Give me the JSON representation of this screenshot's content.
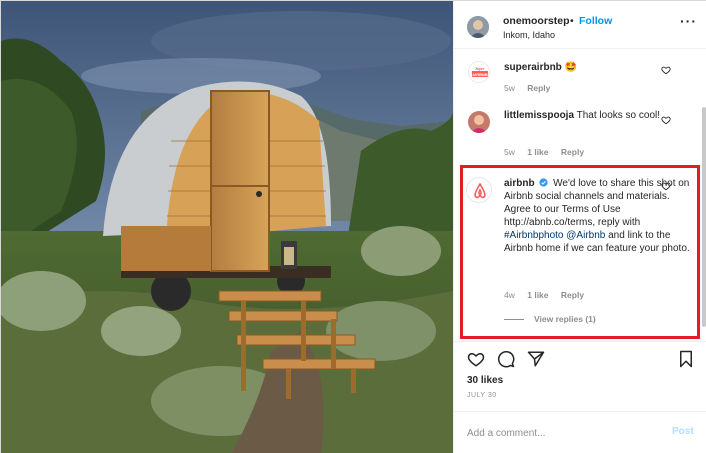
{
  "header": {
    "username": "onemoorstep",
    "separator": "•",
    "follow_label": "Follow",
    "location": "Inkom, Idaho",
    "more_label": "···"
  },
  "comments": [
    {
      "username": "superairbnb",
      "text": "🤩",
      "time": "5w",
      "likes": "",
      "reply_label": "Reply",
      "avatar_text": "AIRBNB"
    },
    {
      "username": "littlemisspooja",
      "text": "That looks so cool!",
      "time": "5w",
      "likes": "1 like",
      "reply_label": "Reply"
    },
    {
      "username": "airbnb",
      "verified": true,
      "text_before": "We'd love to share this shot on Airbnb social channels and materials. Agree to our Terms of Use http://abnb.co/terms, reply with ",
      "link1": "#Airbnbphoto",
      "link2": "@Airbnb",
      "text_after": " and link to the Airbnb home if we can feature your photo.",
      "time": "4w",
      "likes": "1 like",
      "reply_label": "Reply",
      "view_replies": "View replies (1)"
    }
  ],
  "post": {
    "likes": "30 likes",
    "date": "JULY 30"
  },
  "add_comment": {
    "placeholder": "Add a comment...",
    "post_label": "Post"
  },
  "colors": {
    "accent": "#0095f6",
    "highlight": "#e41c25",
    "airbnb": "#ff5a5f",
    "muted": "#8e8e8e"
  },
  "icons": [
    "heart-icon",
    "comment-icon",
    "share-icon",
    "bookmark-icon",
    "verified-icon",
    "more-icon"
  ]
}
